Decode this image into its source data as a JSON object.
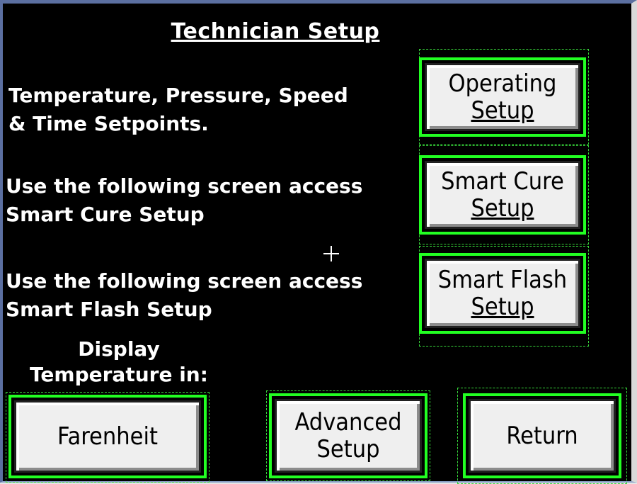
{
  "title": "Technician Setup",
  "sections": [
    {
      "text": [
        "Temperature, Pressure, Speed",
        "& Time Setpoints."
      ],
      "button": [
        "Operating",
        "Setup"
      ]
    },
    {
      "text": [
        "Use the following screen access",
        "Smart Cure Setup"
      ],
      "button": [
        "Smart Cure",
        "Setup"
      ]
    },
    {
      "text": [
        "Use the following screen access",
        "Smart Flash Setup"
      ],
      "button": [
        "Smart Flash",
        "Setup"
      ]
    }
  ],
  "display_label": [
    "Display",
    "Temperature in:"
  ],
  "bottom_buttons": {
    "units": "Farenheit",
    "advanced": [
      "Advanced",
      "Setup"
    ],
    "return": "Return"
  },
  "colors": {
    "background": "#000000",
    "text": "#ffffff",
    "button_face": "#efefef",
    "button_outline": "#22ff22"
  }
}
